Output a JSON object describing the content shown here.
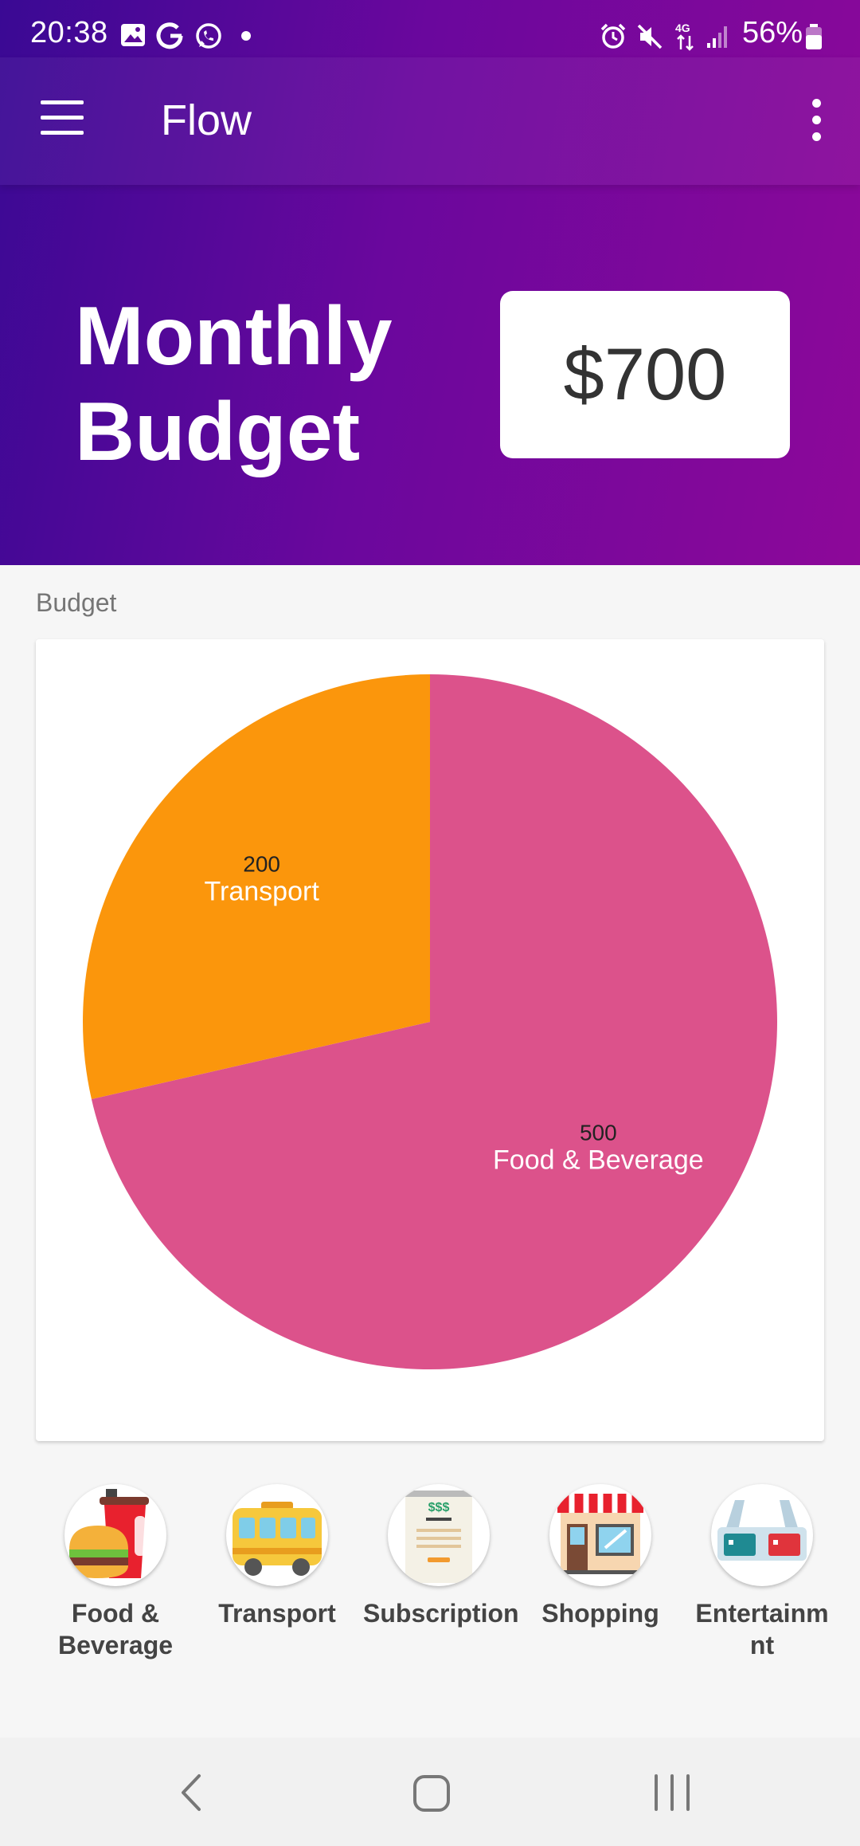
{
  "status_bar": {
    "time": "20:38",
    "battery": "56%",
    "network": "4G"
  },
  "app_bar": {
    "title": "Flow"
  },
  "hero": {
    "title_line1": "Monthly",
    "title_line2": "Budget",
    "amount": "$700"
  },
  "section": {
    "label": "Budget"
  },
  "chart_data": {
    "type": "pie",
    "slices": [
      {
        "label": "Food & Beverage",
        "value": 500,
        "color": "#dc528b"
      },
      {
        "label": "Transport",
        "value": 200,
        "color": "#fb960c"
      }
    ]
  },
  "categories": [
    {
      "line1": "Food &",
      "line2": "Beverage",
      "icon": "burger-drink-icon"
    },
    {
      "line1": "Transport",
      "line2": "",
      "icon": "bus-icon"
    },
    {
      "line1": "Subscription",
      "line2": "",
      "icon": "receipt-icon"
    },
    {
      "line1": "Shopping",
      "line2": "",
      "icon": "store-icon"
    },
    {
      "line1": "Entertainm",
      "line2": "nt",
      "icon": "3d-glasses-icon"
    }
  ]
}
